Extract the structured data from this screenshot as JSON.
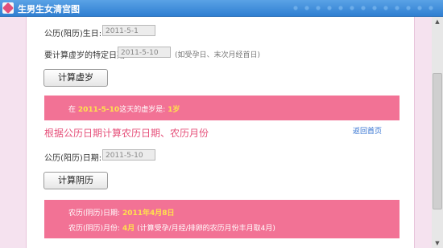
{
  "window": {
    "title": "生男生女清宫图"
  },
  "form1": {
    "birthday_label": "公历(阳历)生日:",
    "birthday_value": "2011-5-1",
    "target_date_label": "要计算虚岁的特定日期",
    "target_date_value": "2011-5-10",
    "target_date_hint": "(如受孕日、末次月经首日)",
    "calc_button": "计算虚岁"
  },
  "result1": {
    "prefix": "在",
    "date": "2011-5-10",
    "middle": "这天的虚岁是:",
    "age": "1岁"
  },
  "section2": {
    "title": "根据公历日期计算农历日期、农历月份",
    "back_link": "返回首页",
    "date_label": "公历(阳历)日期:",
    "date_value": "2011-5-10",
    "calc_button": "计算阴历"
  },
  "result2": {
    "lunar_date_label": "农历(阴历)日期:",
    "lunar_date_value": "2011年4月8日",
    "lunar_month_label": "农历(阴历)月份:",
    "lunar_month_value": "4月",
    "lunar_month_note": "(计算受孕/月经/排卵的农历月份丰月取4月)"
  },
  "colors": {
    "band": "#f27295",
    "highlight": "#ffe14d",
    "title_pink": "#e6507a",
    "link_blue": "#2f6fd0"
  }
}
